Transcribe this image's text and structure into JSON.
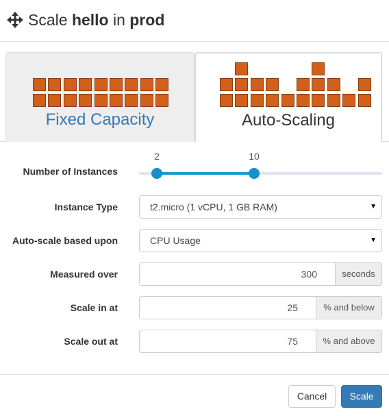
{
  "header": {
    "icon": "move-icon",
    "title_prefix": "Scale",
    "app_name": "hello",
    "title_middle": "in",
    "environment": "prod"
  },
  "tabs": [
    {
      "label": "Fixed Capacity",
      "icon": "fixed-capacity-blocks-icon",
      "selected": false
    },
    {
      "label": "Auto-Scaling",
      "icon": "auto-scaling-blocks-icon",
      "selected": true
    }
  ],
  "form": {
    "instances": {
      "label": "Number of Instances",
      "min_value": "2",
      "max_value": "10"
    },
    "instance_type": {
      "label": "Instance Type",
      "value": "t2.micro (1 vCPU, 1 GB RAM)"
    },
    "autoscale_basis": {
      "label": "Auto-scale based upon",
      "value": "CPU Usage"
    },
    "measured_over": {
      "label": "Measured over",
      "value": "300",
      "unit": "seconds"
    },
    "scale_in": {
      "label": "Scale in at",
      "value": "25",
      "unit": "% and below"
    },
    "scale_out": {
      "label": "Scale out at",
      "value": "75",
      "unit": "% and above"
    }
  },
  "footer": {
    "cancel_label": "Cancel",
    "scale_label": "Scale"
  },
  "colors": {
    "accent": "#337ab7",
    "slider": "#1f9bd1",
    "block_fill": "#d2601a",
    "block_border": "#8a3c0d"
  }
}
